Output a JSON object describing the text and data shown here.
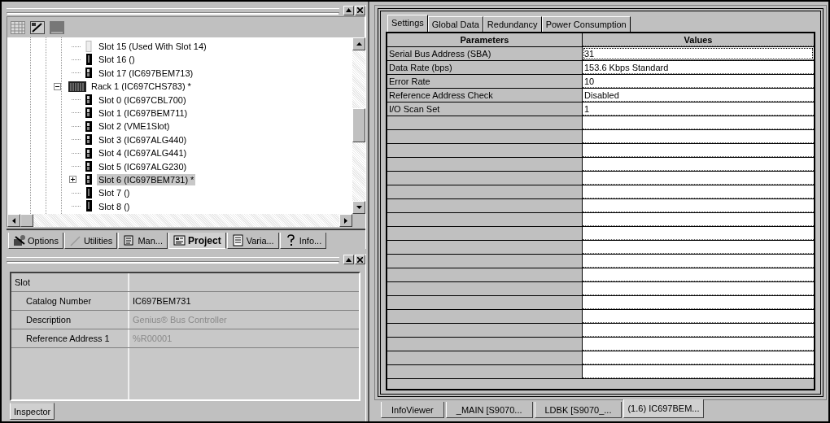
{
  "left_top_pane": {
    "tree": {
      "nodes": [
        {
          "children": [
            {
              "label": "Slot 15 (Used With Slot 14)",
              "kind": "used",
              "selected": false
            },
            {
              "label": "Slot 16 ()",
              "kind": "empty",
              "selected": false
            },
            {
              "label": "Slot 17 (IC697BEM713)",
              "kind": "module",
              "selected": false
            }
          ]
        },
        {
          "label": "Rack 1 (IC697CHS783) *",
          "kind": "rack",
          "expanded": true,
          "selected": false,
          "children": [
            {
              "label": "Slot 0 (IC697CBL700)",
              "kind": "module",
              "selected": false
            },
            {
              "label": "Slot 1 (IC697BEM711)",
              "kind": "module",
              "selected": false
            },
            {
              "label": "Slot 2 (VME1Slot)",
              "kind": "module",
              "selected": false
            },
            {
              "label": "Slot 3 (IC697ALG440)",
              "kind": "module",
              "selected": false
            },
            {
              "label": "Slot 4 (IC697ALG441)",
              "kind": "module",
              "selected": false
            },
            {
              "label": "Slot 5 (IC697ALG230)",
              "kind": "module",
              "selected": false
            },
            {
              "label": "Slot 6 (IC697BEM731) *",
              "kind": "module",
              "selected": true,
              "expanded": false
            },
            {
              "label": "Slot 7 ()",
              "kind": "empty",
              "selected": false
            },
            {
              "label": "Slot 8 ()",
              "kind": "empty",
              "selected": false
            }
          ]
        }
      ]
    },
    "tabs": [
      {
        "label": "Options",
        "kind": "options",
        "selected": false
      },
      {
        "label": "Utilities",
        "kind": "utilities",
        "selected": false
      },
      {
        "label": "Man...",
        "kind": "manuals",
        "selected": false
      },
      {
        "label": "Project",
        "kind": "project",
        "selected": true
      },
      {
        "label": "Varia...",
        "kind": "variables",
        "selected": false
      },
      {
        "label": "Info...",
        "kind": "info",
        "selected": false
      }
    ]
  },
  "inspector": {
    "category": "Slot",
    "rows": [
      {
        "name": "Catalog Number",
        "value": "IC697BEM731",
        "disabled": false
      },
      {
        "name": "Description",
        "value": "Genius® Bus Controller",
        "disabled": true
      },
      {
        "name": "Reference Address 1",
        "value": "%R00001",
        "disabled": true
      }
    ],
    "tab": "Inspector"
  },
  "editor": {
    "tabs": [
      {
        "label": "Settings",
        "selected": true
      },
      {
        "label": "Global Data",
        "selected": false
      },
      {
        "label": "Redundancy",
        "selected": false
      },
      {
        "label": "Power Consumption",
        "selected": false
      }
    ],
    "columns": [
      "Parameters",
      "Values"
    ],
    "rows": [
      {
        "parameter": "Serial Bus Address (SBA)",
        "value": "31",
        "selected": true
      },
      {
        "parameter": "Data Rate (bps)",
        "value": "153.6 Kbps Standard",
        "selected": false
      },
      {
        "parameter": "Error Rate",
        "value": "10",
        "selected": false
      },
      {
        "parameter": "Reference Address Check",
        "value": "Disabled",
        "selected": false
      },
      {
        "parameter": "I/O Scan Set",
        "value": "1",
        "selected": false
      }
    ]
  },
  "document_tabs": [
    {
      "label": "InfoViewer",
      "selected": false
    },
    {
      "label": "_MAIN [S9070...",
      "selected": false
    },
    {
      "label": "LDBK [S9070_...",
      "selected": false
    },
    {
      "label": "(1.6) IC697BEM...",
      "selected": true
    }
  ]
}
